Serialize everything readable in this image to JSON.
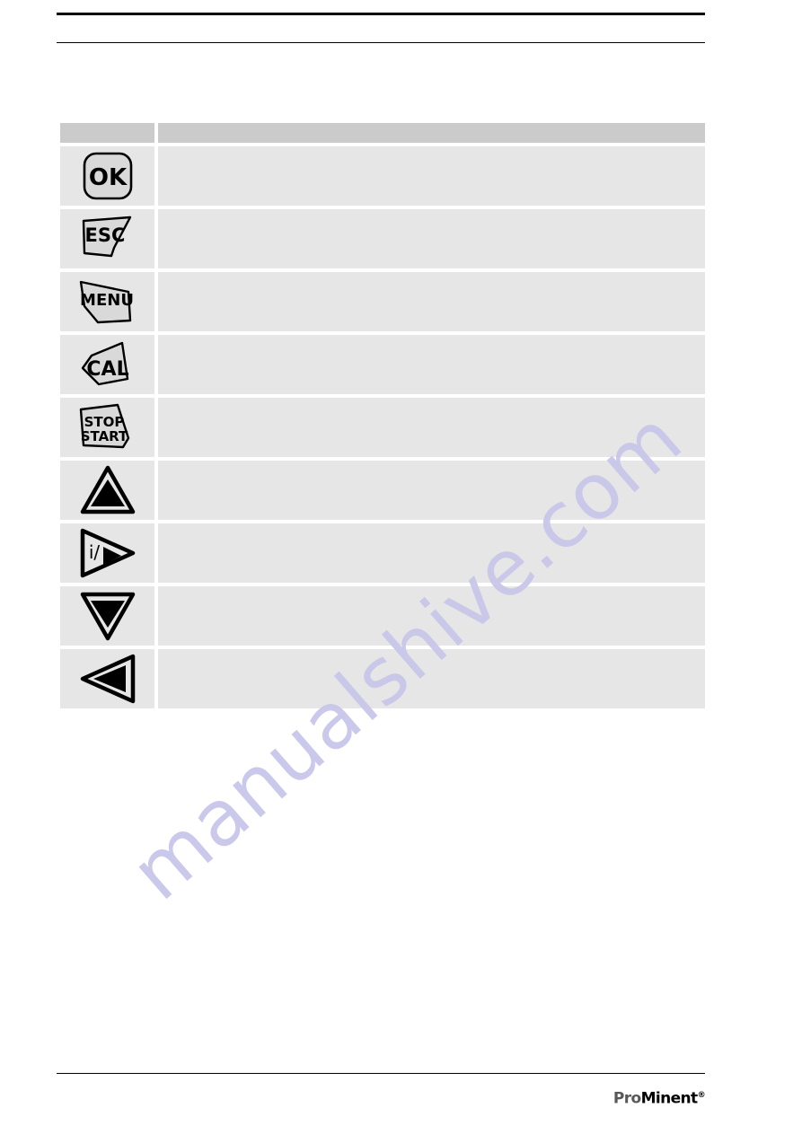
{
  "document": {
    "header_title": "",
    "section_heading": "",
    "page_number": ""
  },
  "watermark": {
    "text": "manualshive.com",
    "color": "#c9c7ea",
    "rotation_deg": -41
  },
  "key_table": {
    "columns": [
      {
        "id": "key",
        "header": ""
      },
      {
        "id": "description",
        "header": ""
      }
    ],
    "rows": [
      {
        "icon": "key-ok-icon",
        "key_label": "OK",
        "description": ""
      },
      {
        "icon": "key-esc-icon",
        "key_label": "ESC",
        "description": ""
      },
      {
        "icon": "key-menu-icon",
        "key_label": "MENU",
        "description": ""
      },
      {
        "icon": "key-cal-icon",
        "key_label": "CAL",
        "description": ""
      },
      {
        "icon": "key-stop-start-icon",
        "key_label": "STOP START",
        "description": ""
      },
      {
        "icon": "arrow-up-icon",
        "key_label": "",
        "description": ""
      },
      {
        "icon": "info-right-arrow-icon",
        "key_label": "i/",
        "description": ""
      },
      {
        "icon": "arrow-down-icon",
        "key_label": "",
        "description": ""
      },
      {
        "icon": "arrow-left-icon",
        "key_label": "",
        "description": ""
      }
    ]
  },
  "footer": {
    "brand_pro": "Pro",
    "brand_minent": "Minent",
    "brand_registered": "®"
  },
  "colors": {
    "table_header_bg": "#cbcbcb",
    "table_row_bg": "#e6e6e6",
    "page_bg": "#ffffff",
    "rule": "#000000",
    "brand_gray": "#58585a"
  }
}
